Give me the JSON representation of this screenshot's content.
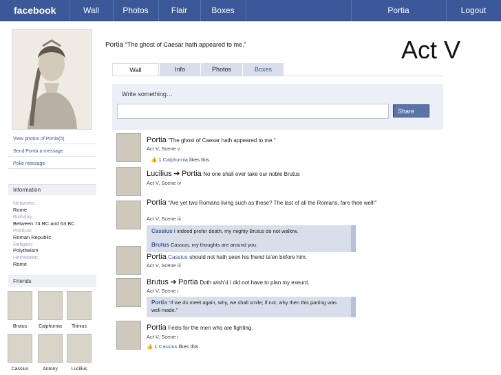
{
  "nav": {
    "brand": "facebook",
    "items": [
      "Wall",
      "Photos",
      "Flair",
      "Boxes"
    ],
    "user": "Portia",
    "logout": "Logout"
  },
  "sidebar": {
    "links": [
      "View photos of Portia(5)",
      "Send Portia a message",
      "Poke message"
    ],
    "information_title": "Information",
    "info": [
      {
        "label": "Networks:",
        "value": "Rome"
      },
      {
        "label": "Birthday:",
        "value": "Between 74 BC and 63 BC"
      },
      {
        "label": "Political:",
        "value": "Roman Republic"
      },
      {
        "label": "Religion:",
        "value": "Polytheism"
      },
      {
        "label": "Hometown:",
        "value": "Rome"
      }
    ],
    "friends_title": "Friends",
    "friends": [
      "Brutus",
      "Calphurnia",
      "Titinius",
      "Cassius",
      "Antony",
      "Lucilius"
    ]
  },
  "header": {
    "name": "Portia",
    "status": "“The ghost of Caesar hath appeared to me.”",
    "act": "Act V"
  },
  "tabs": [
    "Wall",
    "Info",
    "Photos",
    "Boxes"
  ],
  "publisher": {
    "prompt": "Write something…",
    "input_value": "",
    "share": "Share"
  },
  "feed": {
    "s1": {
      "author": "Portia",
      "text": "“The ghost of Caesar hath appeared to me.”",
      "meta": "Act V, Scene v",
      "likes": "1",
      "liker": "Calphurnia",
      "likes_text": "likes this."
    },
    "s2": {
      "author": "Lucilius",
      "arrow": "➔",
      "target": "Portia",
      "text": "No one shall ever take our noble Brutus",
      "meta": "Act V, Scene iv"
    },
    "s3": {
      "author": "Portia",
      "text": "“Are yet two Romans living such as these? The last of all the Romans, fare thee well!”",
      "meta": "Act V, Scene iii",
      "comments": [
        {
          "author": "Cassius",
          "text": "I indeed prefer death, my mighty Brutus do not wallow."
        },
        {
          "author": "Brutus",
          "text": "Cassius, my thoughts are around you."
        }
      ]
    },
    "s4": {
      "author": "Portia",
      "mention": "Cassius",
      "text": "should not hath seen his friend ta’en before him.",
      "meta": "Act V, Scene iii"
    },
    "s5": {
      "author": "Brutus",
      "arrow": "➔",
      "target": "Portia",
      "text": "Doth wish’d I did not have to plan my exeunt.",
      "meta": "Act V, Scene i",
      "comment": {
        "author": "Portia",
        "text": "“If we do meet again, why, we shall smile; if not, why then this parting was well made.”"
      }
    },
    "s6": {
      "author": "Portia",
      "text": "Feels for the men who are fighting.",
      "meta": "Act V, Scene i",
      "likes": "1",
      "liker": "Cassius",
      "likes_text": "likes this."
    }
  },
  "colors": {
    "brand": "#3b5998",
    "nav_text": "#ffffff",
    "panel": "#eceff5",
    "tab": "#d8dfea",
    "comment": "#d8dfea"
  }
}
